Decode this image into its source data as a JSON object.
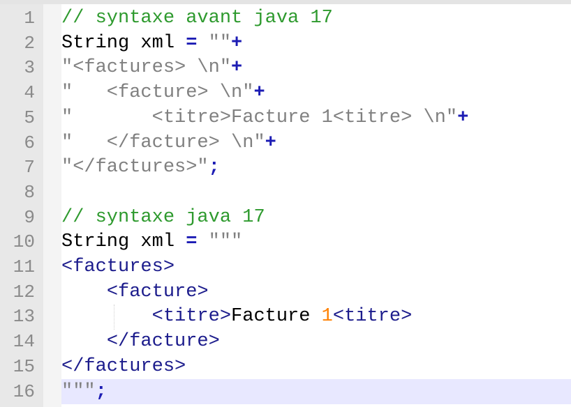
{
  "editor": {
    "lines": [
      {
        "number": "1",
        "segments": [
          {
            "text": "// syntaxe avant java 17",
            "cls": "c"
          }
        ]
      },
      {
        "number": "2",
        "segments": [
          {
            "text": "String xml ",
            "cls": "k"
          },
          {
            "text": "=",
            "cls": "op"
          },
          {
            "text": " \"\"",
            "cls": "s"
          },
          {
            "text": "+",
            "cls": "op"
          }
        ]
      },
      {
        "number": "3",
        "segments": [
          {
            "text": "\"<factures> \\n\"",
            "cls": "s"
          },
          {
            "text": "+",
            "cls": "op"
          }
        ]
      },
      {
        "number": "4",
        "segments": [
          {
            "text": "\"   <facture> \\n\"",
            "cls": "s"
          },
          {
            "text": "+",
            "cls": "op"
          }
        ]
      },
      {
        "number": "5",
        "segments": [
          {
            "text": "\"       <titre>Facture 1<titre> \\n\"",
            "cls": "s"
          },
          {
            "text": "+",
            "cls": "op"
          }
        ]
      },
      {
        "number": "6",
        "segments": [
          {
            "text": "\"   </facture> \\n\"",
            "cls": "s"
          },
          {
            "text": "+",
            "cls": "op"
          }
        ]
      },
      {
        "number": "7",
        "segments": [
          {
            "text": "\"</factures>\"",
            "cls": "s"
          },
          {
            "text": ";",
            "cls": "op"
          }
        ]
      },
      {
        "number": "8",
        "segments": []
      },
      {
        "number": "9",
        "segments": [
          {
            "text": "// syntaxe java 17",
            "cls": "c"
          }
        ]
      },
      {
        "number": "10",
        "segments": [
          {
            "text": "String xml ",
            "cls": "k"
          },
          {
            "text": "=",
            "cls": "op"
          },
          {
            "text": " \"\"\"",
            "cls": "s"
          }
        ]
      },
      {
        "number": "11",
        "segments": [
          {
            "text": "<factures>",
            "cls": "t"
          }
        ]
      },
      {
        "number": "12",
        "segments": [
          {
            "text": "    ",
            "cls": "k"
          },
          {
            "text": "<facture>",
            "cls": "t"
          }
        ]
      },
      {
        "number": "13",
        "segments": [
          {
            "text": "        ",
            "cls": "k"
          },
          {
            "text": "<titre>",
            "cls": "t"
          },
          {
            "text": "Facture ",
            "cls": "k"
          },
          {
            "text": "1",
            "cls": "n"
          },
          {
            "text": "<titre>",
            "cls": "t"
          }
        ]
      },
      {
        "number": "14",
        "segments": [
          {
            "text": "    ",
            "cls": "k"
          },
          {
            "text": "</facture>",
            "cls": "t"
          }
        ]
      },
      {
        "number": "15",
        "segments": [
          {
            "text": "</factures>",
            "cls": "t"
          }
        ]
      },
      {
        "number": "16",
        "segments": [
          {
            "text": "\"\"\"",
            "cls": "s"
          },
          {
            "text": ";",
            "cls": "op"
          }
        ]
      }
    ],
    "current_line": "16"
  },
  "colors": {
    "comment": "#2e9a2e",
    "operator": "#1c1cb4",
    "string": "#808080",
    "xml_tag": "#1c1c8c",
    "number": "#ff8000",
    "current_line_bg": "#e8e8ff",
    "gutter_bg": "#e8e8e8"
  }
}
